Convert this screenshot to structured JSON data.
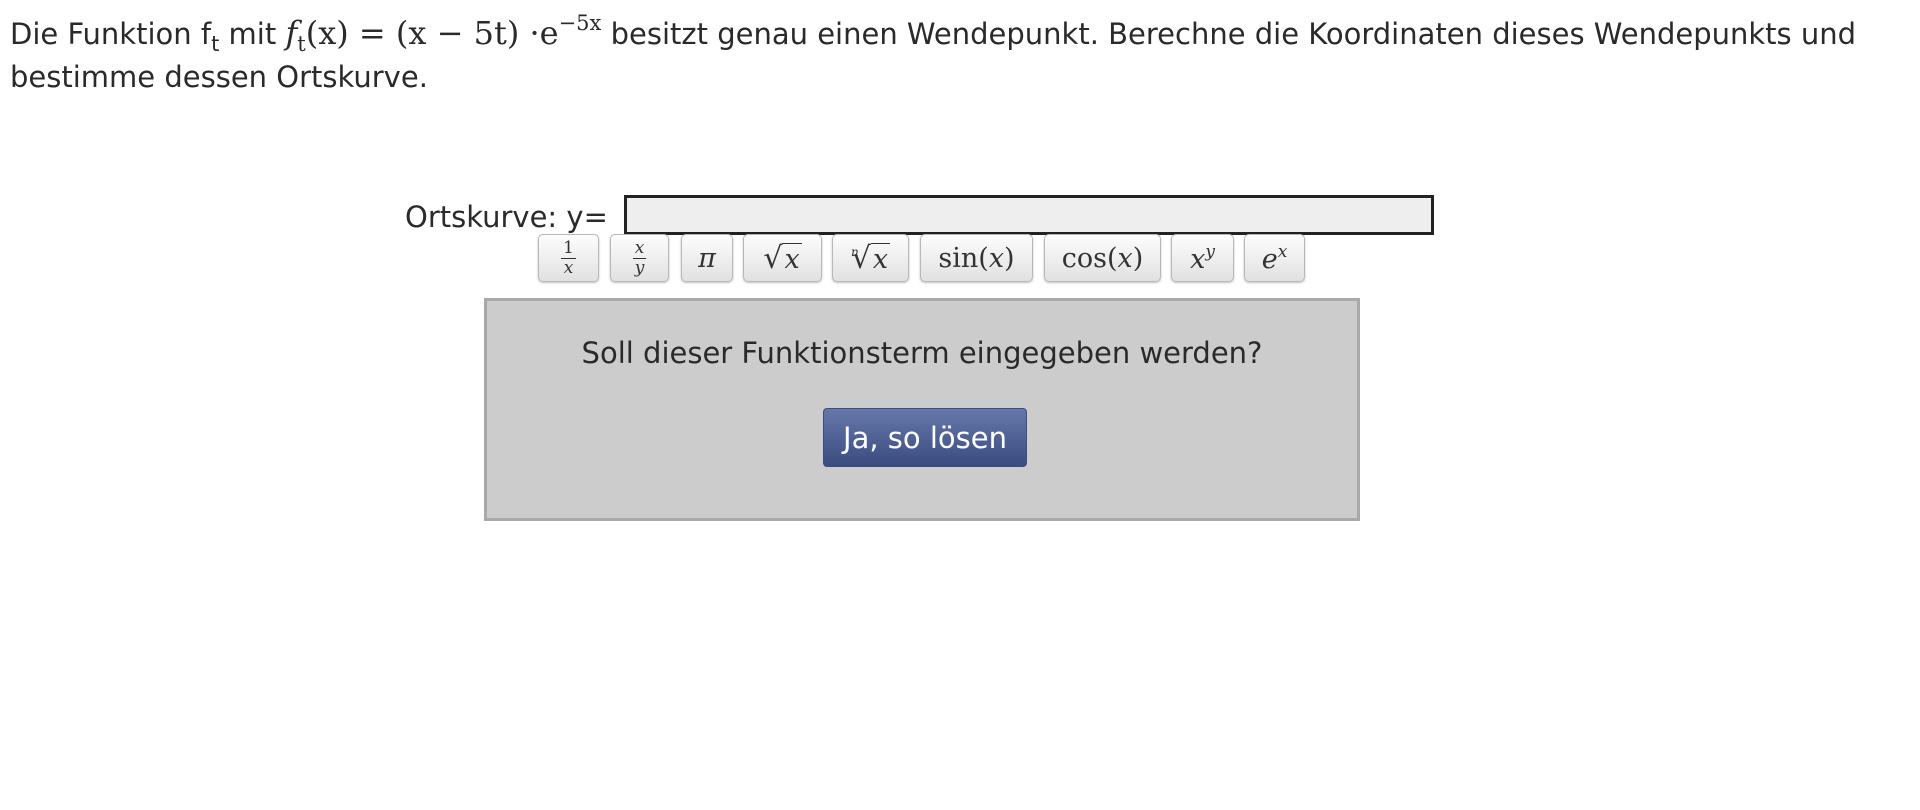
{
  "task": {
    "intro": "Die Funktion f",
    "intro_sub": "t",
    "intro_mid": " mit ",
    "formula_f": "f",
    "formula_sub": "t",
    "formula_rest": "(x) = (x − 5t) ·e",
    "formula_exp": "−5x",
    "text_after": " besitzt genau einen Wendepunkt. Berechne die Koordinaten dieses Wendepunkts und bestimme dessen Ortskurve."
  },
  "answer": {
    "label": "Ortskurve: y=",
    "value": ""
  },
  "keyboard": {
    "reciprocal_num": "1",
    "reciprocal_den": "x",
    "fraction_num": "x",
    "fraction_den": "y",
    "pi": "π",
    "sqrt_sign": "√",
    "sqrt_arg": "x",
    "nthroot_index": "n",
    "nthroot_sign": "√",
    "nthroot_arg": "x",
    "sin_fn": "sin(",
    "sin_arg": "x",
    "sin_close": ")",
    "cos_fn": "cos(",
    "cos_arg": "x",
    "cos_close": ")",
    "pow_base": "x",
    "pow_exp": "y",
    "exp_base": "e",
    "exp_exp": "x"
  },
  "confirm": {
    "question": "Soll dieser Funktionsterm eingegeben werden?",
    "button_label": "Ja, so lösen",
    "button_color": "#4a5b8e",
    "box_color": "#cccccc"
  }
}
